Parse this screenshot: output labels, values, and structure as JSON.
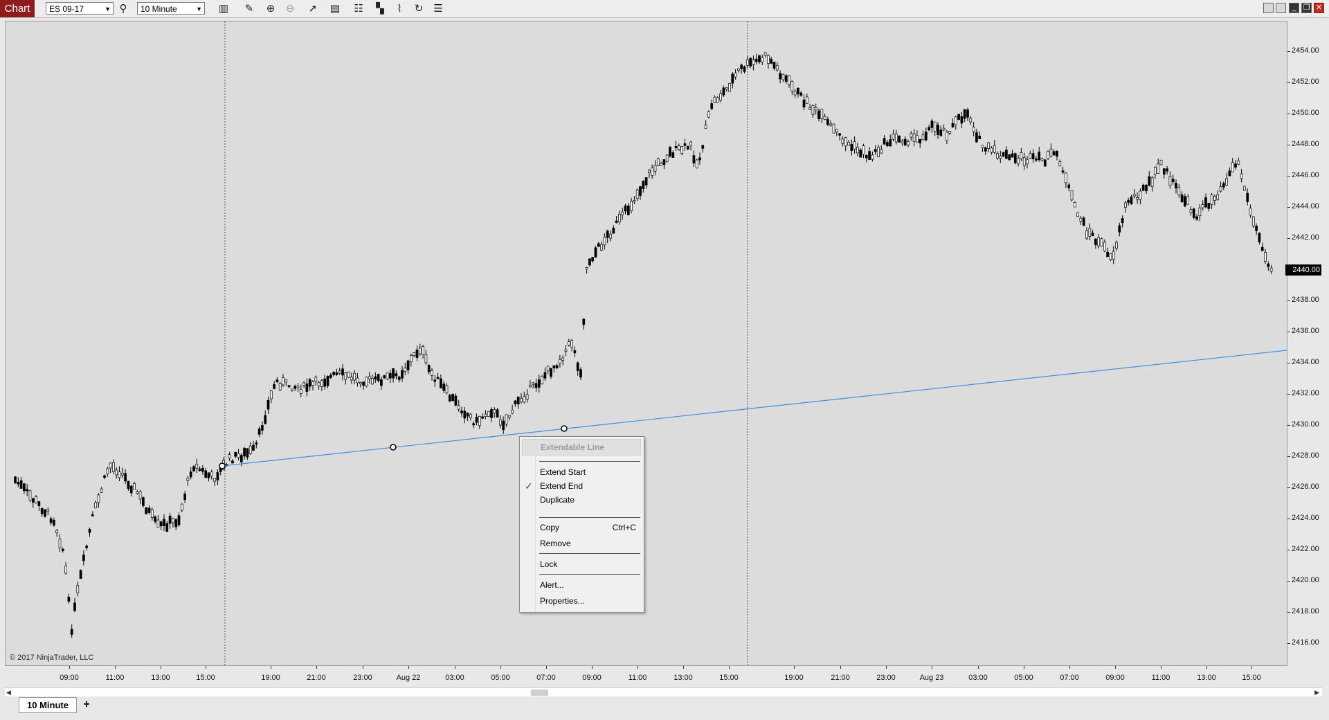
{
  "app": {
    "title": "Chart"
  },
  "toolbar": {
    "instrument": "ES 09-17",
    "interval": "10 Minute",
    "icons": [
      "search-icon",
      "bars-type-icon",
      "draw-pencil-icon",
      "zoom-in-icon",
      "zoom-out-icon",
      "cursor-icon",
      "data-box-icon",
      "indicators-icon",
      "strategies-icon",
      "drawing-tools-icon",
      "refresh-icon",
      "properties-list-icon"
    ],
    "window_controls": [
      "tile-icon",
      "pin-icon",
      "minimize-icon",
      "restore-icon",
      "close-icon"
    ]
  },
  "chart": {
    "copyright": "© 2017 NinjaTrader, LLC",
    "last_price": "2440.00",
    "price_axis_labels": [
      "2454.00",
      "2452.00",
      "2450.00",
      "2448.00",
      "2446.00",
      "2444.00",
      "2442.00",
      "2440.00",
      "2438.00",
      "2436.00",
      "2434.00",
      "2432.00",
      "2430.00",
      "2428.00",
      "2426.00",
      "2424.00",
      "2422.00",
      "2420.00",
      "2418.00",
      "2416.00"
    ],
    "time_axis_labels": [
      "09:00",
      "11:00",
      "13:00",
      "15:00",
      "19:00",
      "21:00",
      "23:00",
      "Aug 22",
      "03:00",
      "05:00",
      "07:00",
      "09:00",
      "11:00",
      "13:00",
      "15:00",
      "19:00",
      "21:00",
      "23:00",
      "Aug 23",
      "03:00",
      "05:00",
      "07:00",
      "09:00",
      "11:00",
      "13:00",
      "15:00"
    ],
    "line_color": "#3d8fe0",
    "candle_color": "#000000",
    "candle_up_fill": "#ffffff",
    "background_color": "#dcdcdc"
  },
  "context_menu": {
    "header": "Extendable Line",
    "items": [
      {
        "label": "Extend Start",
        "checked": false,
        "shortcut": ""
      },
      {
        "label": "Extend End",
        "checked": true,
        "shortcut": ""
      },
      {
        "label": "Duplicate",
        "checked": false,
        "shortcut": ""
      },
      {
        "label": "Copy",
        "checked": false,
        "shortcut": "Ctrl+C"
      },
      {
        "label": "Remove",
        "checked": false,
        "shortcut": ""
      },
      {
        "label": "Lock",
        "checked": false,
        "shortcut": ""
      },
      {
        "label": "Alert...",
        "checked": false,
        "shortcut": ""
      },
      {
        "label": "Properties...",
        "checked": false,
        "shortcut": ""
      }
    ],
    "check_mark": "✓"
  },
  "tabs": {
    "active": "10 Minute",
    "add": "+"
  }
}
